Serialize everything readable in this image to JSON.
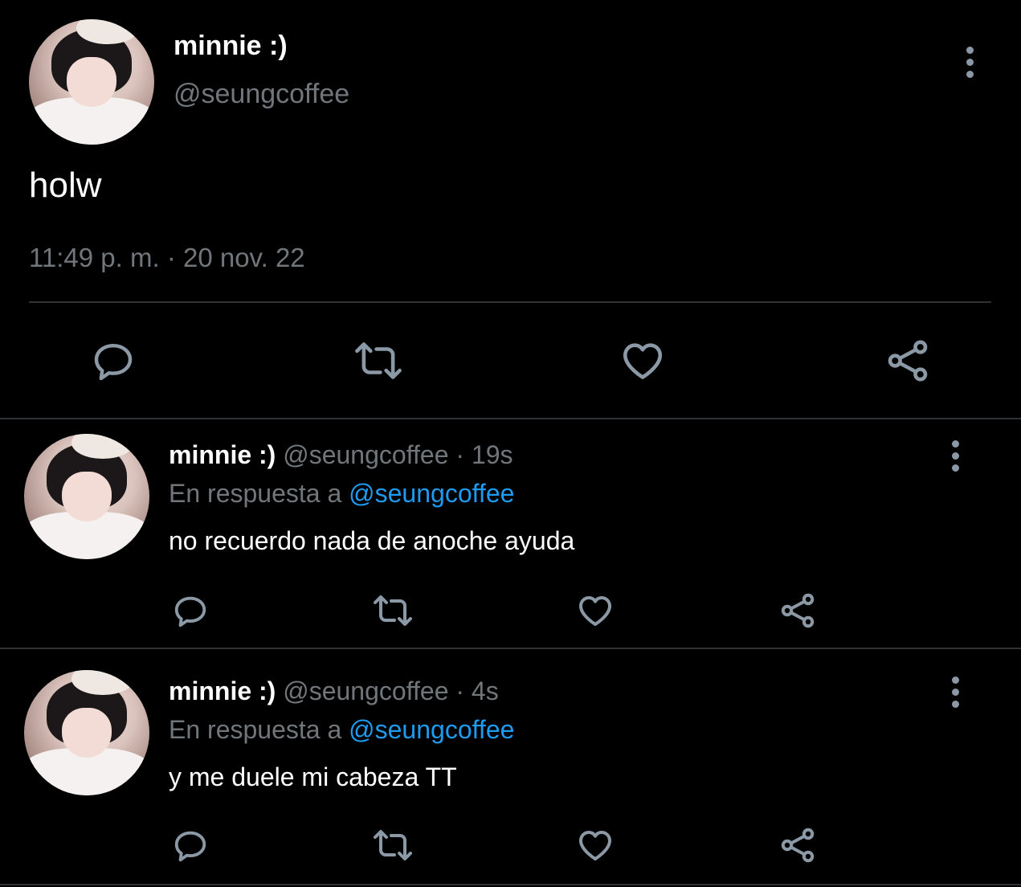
{
  "main_tweet": {
    "display_name": "minnie :)",
    "handle": "@seungcoffee",
    "text": "holw",
    "timestamp": "11:49 p. m. · 20 nov. 22"
  },
  "replies": [
    {
      "display_name": "minnie :)",
      "handle_time": "@seungcoffee · 19s",
      "reply_prefix": "En respuesta a",
      "reply_to": "@seungcoffee",
      "text": "no recuerdo nada de anoche ayuda"
    },
    {
      "display_name": "minnie :)",
      "handle_time": "@seungcoffee · 4s",
      "reply_prefix": "En respuesta a",
      "reply_to": "@seungcoffee",
      "text": "y me duele mi cabeza TT"
    }
  ],
  "icons": [
    "reply-icon",
    "retweet-icon",
    "like-icon",
    "share-icon",
    "more-options-icon"
  ],
  "colors": {
    "background": "#000000",
    "text": "#e7e9ea",
    "muted": "#71767b",
    "link": "#1d9bf0",
    "icon": "#8b98a5"
  }
}
